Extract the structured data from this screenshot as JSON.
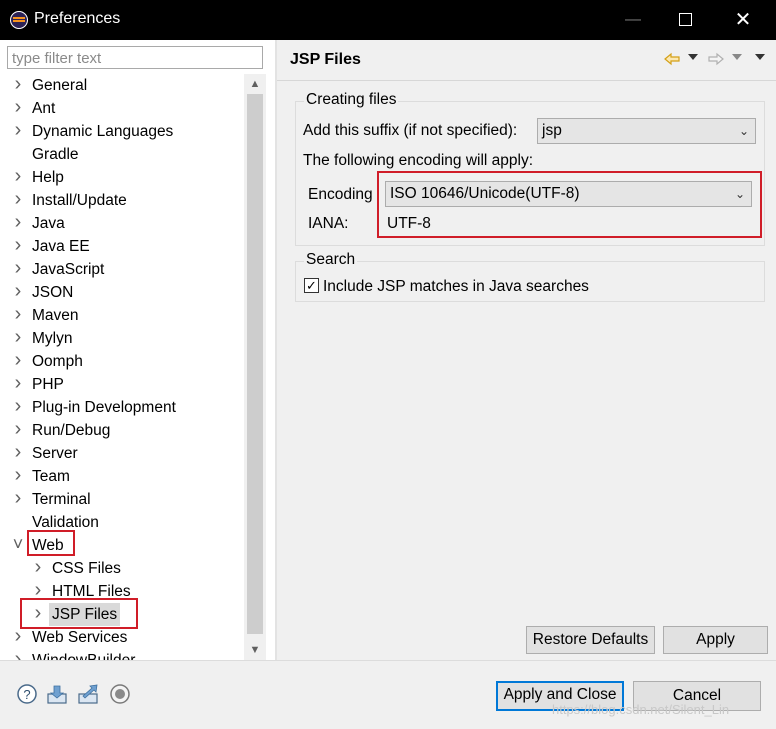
{
  "window": {
    "title": "Preferences"
  },
  "filter": {
    "placeholder": "type filter text"
  },
  "tree": [
    {
      "label": "General",
      "expander": "collapsed",
      "level": 0
    },
    {
      "label": "Ant",
      "expander": "collapsed",
      "level": 0
    },
    {
      "label": "Dynamic Languages",
      "expander": "collapsed",
      "level": 0
    },
    {
      "label": "Gradle",
      "expander": "none",
      "level": 0
    },
    {
      "label": "Help",
      "expander": "collapsed",
      "level": 0
    },
    {
      "label": "Install/Update",
      "expander": "collapsed",
      "level": 0
    },
    {
      "label": "Java",
      "expander": "collapsed",
      "level": 0
    },
    {
      "label": "Java EE",
      "expander": "collapsed",
      "level": 0
    },
    {
      "label": "JavaScript",
      "expander": "collapsed",
      "level": 0
    },
    {
      "label": "JSON",
      "expander": "collapsed",
      "level": 0
    },
    {
      "label": "Maven",
      "expander": "collapsed",
      "level": 0
    },
    {
      "label": "Mylyn",
      "expander": "collapsed",
      "level": 0
    },
    {
      "label": "Oomph",
      "expander": "collapsed",
      "level": 0
    },
    {
      "label": "PHP",
      "expander": "collapsed",
      "level": 0
    },
    {
      "label": "Plug-in Development",
      "expander": "collapsed",
      "level": 0
    },
    {
      "label": "Run/Debug",
      "expander": "collapsed",
      "level": 0
    },
    {
      "label": "Server",
      "expander": "collapsed",
      "level": 0
    },
    {
      "label": "Team",
      "expander": "collapsed",
      "level": 0
    },
    {
      "label": "Terminal",
      "expander": "collapsed",
      "level": 0
    },
    {
      "label": "Validation",
      "expander": "none",
      "level": 0
    },
    {
      "label": "Web",
      "expander": "expanded",
      "level": 0,
      "highlighted": true
    },
    {
      "label": "CSS Files",
      "expander": "collapsed",
      "level": 1
    },
    {
      "label": "HTML Files",
      "expander": "collapsed",
      "level": 1
    },
    {
      "label": "JSP Files",
      "expander": "collapsed",
      "level": 1,
      "selected": true,
      "highlighted": true
    },
    {
      "label": "Web Services",
      "expander": "collapsed",
      "level": 0
    },
    {
      "label": "WindowBuilder",
      "expander": "collapsed",
      "level": 0
    }
  ],
  "page": {
    "title": "JSP Files",
    "nav_icons": [
      "back-arrow-icon",
      "back-menu-icon",
      "forward-arrow-icon",
      "forward-menu-icon",
      "view-menu-icon"
    ],
    "creating_files": {
      "legend": "Creating files",
      "suffix_label": "Add this suffix (if not specified):",
      "suffix_value": "jsp",
      "encoding_intro": "The following encoding will apply:",
      "encoding_label": "Encoding",
      "encoding_value": "ISO 10646/Unicode(UTF-8)",
      "iana_label": "IANA:",
      "iana_value": "UTF-8"
    },
    "search": {
      "legend": "Search",
      "include_label": "Include JSP matches in Java searches",
      "include_checked": true
    },
    "buttons": {
      "restore_defaults": "Restore Defaults",
      "apply": "Apply"
    }
  },
  "footer": {
    "icons": [
      "help-icon",
      "import-icon",
      "export-icon",
      "record-icon"
    ],
    "apply_close": "Apply and Close",
    "cancel": "Cancel"
  },
  "watermark": "https://blog.csdn.net/Silent_Lin",
  "colors": {
    "highlight_red": "#d01d28",
    "default_button_border": "#0078d7",
    "titlebar": "#000000"
  }
}
